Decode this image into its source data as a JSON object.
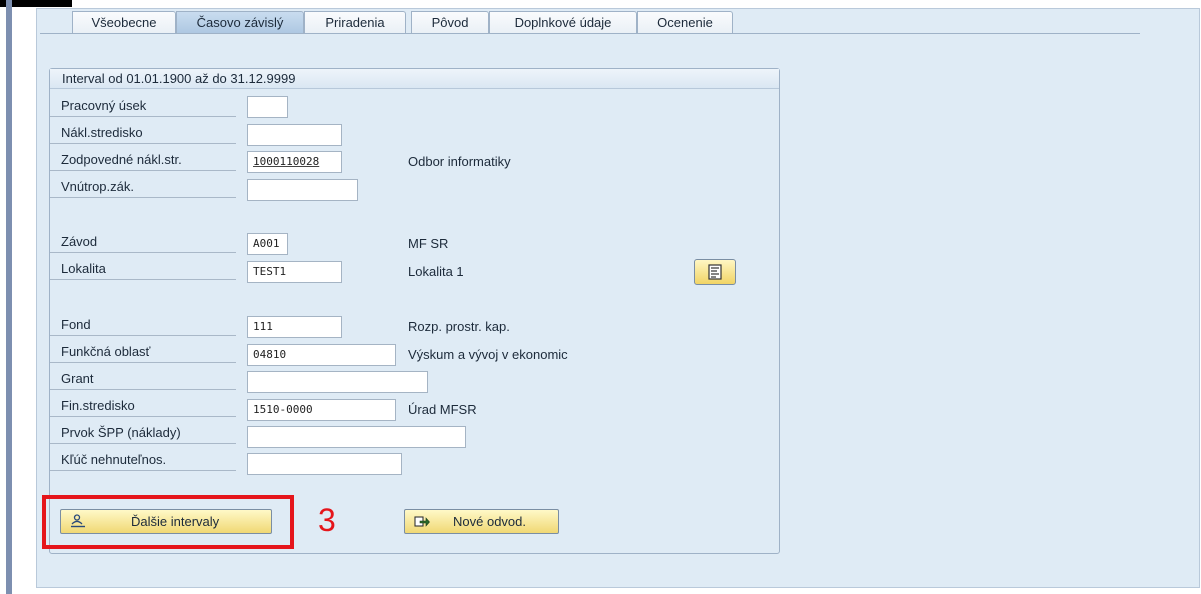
{
  "tabs": [
    {
      "label": "Všeobecne",
      "active": false
    },
    {
      "label": "Časovo závislý",
      "active": true
    },
    {
      "label": "Priradenia",
      "active": false
    },
    {
      "label": "Pôvod",
      "active": false
    },
    {
      "label": "Doplnkové údaje",
      "active": false
    },
    {
      "label": "Ocenenie",
      "active": false
    }
  ],
  "group": {
    "title": "Interval od 01.01.1900 až do 31.12.9999"
  },
  "fields": {
    "pracovny_usek": {
      "label": "Pracovný úsek",
      "value": ""
    },
    "nakl_stredisko": {
      "label": "Nákl.stredisko",
      "value": ""
    },
    "zodpovedne": {
      "label": "Zodpovedné nákl.str.",
      "value": "1000110028",
      "description": "Odbor informatiky"
    },
    "vnutrop": {
      "label": "Vnútrop.zák.",
      "value": ""
    },
    "zavod": {
      "label": "Závod",
      "value": "A001",
      "description": "MF SR"
    },
    "lokalita": {
      "label": "Lokalita",
      "value": "TEST1",
      "description": "Lokalita 1"
    },
    "fond": {
      "label": "Fond",
      "value": "111",
      "description": "Rozp. prostr. kap."
    },
    "funkcna": {
      "label": "Funkčná oblasť",
      "value": "04810",
      "description": "Výskum a vývoj v ekonomic"
    },
    "grant": {
      "label": "Grant",
      "value": ""
    },
    "fin_stredisko": {
      "label": "Fin.stredisko",
      "value": "1510-0000",
      "description": "Úrad MFSR"
    },
    "prvok_spp": {
      "label": "Prvok ŠPP (náklady)",
      "value": ""
    },
    "kluc": {
      "label": "Kľúč nehnuteľnos.",
      "value": ""
    }
  },
  "buttons": {
    "dalsie_intervaly": "Ďalšie intervaly",
    "nove_odvod": "Nové odvod."
  },
  "annotation": {
    "step_number": "3",
    "color": "#e5151b"
  },
  "icons": {
    "lokalita_detail": "document-icon",
    "dalsie_intervaly": "intervals-icon",
    "nove_odvod": "derivation-icon"
  }
}
